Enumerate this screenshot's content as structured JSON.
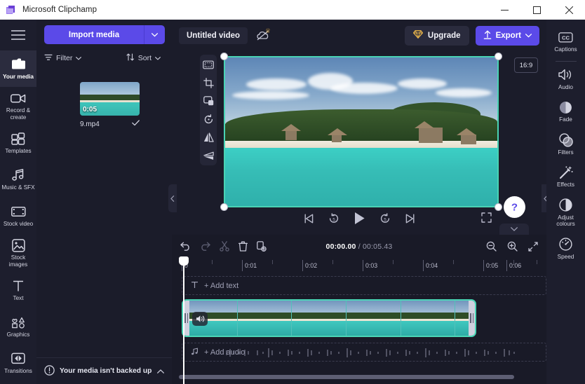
{
  "window": {
    "app_title": "Microsoft Clipchamp",
    "app_icon": "clipchamp-logo-icon",
    "minimize": "–",
    "maximize": "☐",
    "close": "✕"
  },
  "left_rail": {
    "menu_icon": "hamburger-menu-icon",
    "items": [
      {
        "label": "Your media",
        "icon": "folder-icon",
        "active": true
      },
      {
        "label": "Record &\ncreate",
        "icon": "camera-icon",
        "active": false
      },
      {
        "label": "Templates",
        "icon": "templates-grid-icon",
        "active": false
      },
      {
        "label": "Music & SFX",
        "icon": "music-note-icon",
        "active": false
      },
      {
        "label": "Stock video",
        "icon": "film-strip-icon",
        "active": false
      },
      {
        "label": "Stock\nimages",
        "icon": "image-icon",
        "active": false
      },
      {
        "label": "Text",
        "icon": "text-t-icon",
        "active": false
      },
      {
        "label": "Graphics",
        "icon": "shapes-icon",
        "active": false
      },
      {
        "label": "Transitions",
        "icon": "transition-icon",
        "active": false
      }
    ]
  },
  "media_panel": {
    "import_label": "Import media",
    "import_caret_icon": "chevron-down-icon",
    "filter_label": "Filter",
    "filter_icon": "filter-icon",
    "sort_label": "Sort",
    "sort_icon": "sort-arrows-icon",
    "asset": {
      "name": "9.mp4",
      "duration": "0:05",
      "selected_icon": "checkmark-icon"
    }
  },
  "backup_bar": {
    "icon": "alert-circle-icon",
    "message": "Your media isn't backed up",
    "chevron": "chevron-up-icon"
  },
  "topbar": {
    "project_title": "Untitled video",
    "cloud_icon": "cloud-off-icon",
    "crown_icon": "crown-icon",
    "upgrade_label": "Upgrade",
    "upgrade_icon": "diamond-icon",
    "export_label": "Export",
    "export_icon": "upload-arrow-icon",
    "export_caret_icon": "chevron-down-icon"
  },
  "preview": {
    "aspect_ratio": "16:9",
    "tools": [
      {
        "icon": "fit-to-frame-icon"
      },
      {
        "icon": "crop-icon"
      },
      {
        "icon": "picture-in-picture-icon"
      },
      {
        "icon": "rotate-icon"
      },
      {
        "icon": "flip-horizontal-icon"
      },
      {
        "icon": "flip-vertical-icon"
      }
    ],
    "controls": [
      {
        "icon": "skip-to-start-icon"
      },
      {
        "icon": "rewind-5s-icon"
      },
      {
        "icon": "play-icon"
      },
      {
        "icon": "forward-5s-icon"
      },
      {
        "icon": "skip-to-end-icon"
      }
    ],
    "fullscreen_icon": "fullscreen-icon",
    "help_label": "?",
    "collapse_left_icon": "chevron-left-icon",
    "collapse_right_icon": "chevron-left-icon",
    "collapse_down_icon": "chevron-down-icon"
  },
  "timeline": {
    "tools": [
      {
        "icon": "undo-icon",
        "enabled": true
      },
      {
        "icon": "redo-icon",
        "enabled": false
      },
      {
        "icon": "split-scissors-icon",
        "enabled": false
      },
      {
        "icon": "delete-trash-icon",
        "enabled": true
      },
      {
        "icon": "duplicate-icon",
        "enabled": true
      }
    ],
    "current_time": "00:00.00",
    "separator": "/",
    "total_time": "00:05.43",
    "zoom_out_icon": "zoom-out-icon",
    "zoom_in_icon": "zoom-in-icon",
    "fit_icon": "fit-timeline-icon",
    "ruler_ticks": [
      "0",
      "0:01",
      "0:02",
      "0:03",
      "0:04",
      "0:05",
      "0:06"
    ],
    "add_text_label": "+ Add text",
    "add_text_icon": "text-t-icon",
    "add_audio_label": "+ Add audio",
    "add_audio_icon": "music-note-icon",
    "clip_audio_icon": "speaker-icon"
  },
  "right_rail": {
    "items": [
      {
        "label": "Captions",
        "icon": "closed-caption-icon",
        "divider_after": true
      },
      {
        "label": "Audio",
        "icon": "speaker-icon",
        "divider_after": false
      },
      {
        "label": "Fade",
        "icon": "fade-circle-icon",
        "divider_after": false
      },
      {
        "label": "Filters",
        "icon": "filters-circles-icon",
        "divider_after": false
      },
      {
        "label": "Effects",
        "icon": "magic-wand-icon",
        "divider_after": false
      },
      {
        "label": "Adjust\ncolours",
        "icon": "contrast-circle-icon",
        "divider_after": false
      },
      {
        "label": "Speed",
        "icon": "speedometer-icon",
        "divider_after": false
      }
    ]
  },
  "colors": {
    "accent": "#5b4ae8",
    "clip_border": "#4bd6b6",
    "app_bg": "#1b1c2a",
    "panel_bg": "#1d1e2d",
    "timeline_bg": "#191a27"
  }
}
